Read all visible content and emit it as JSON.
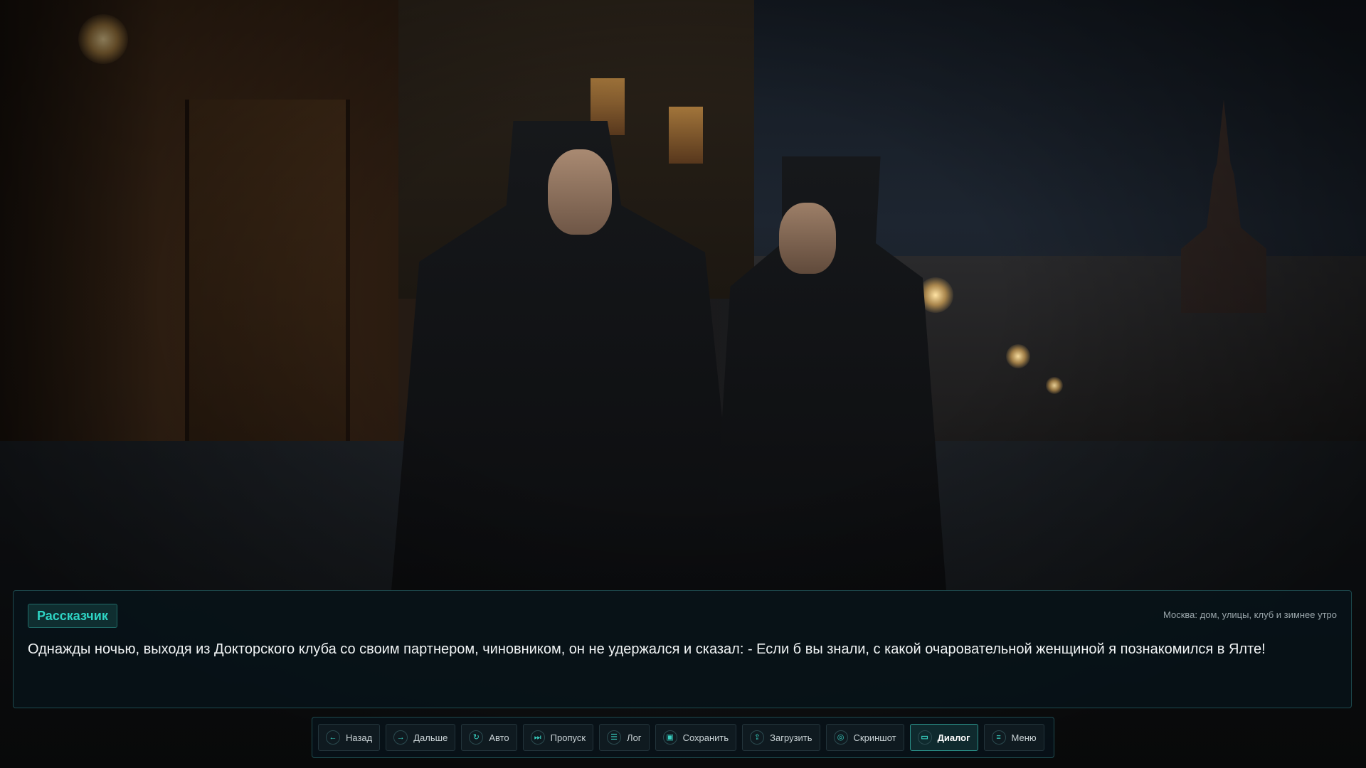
{
  "dialog": {
    "speaker": "Рассказчик",
    "location": "Москва: дом, улицы, клуб и зимнее утро",
    "text": "Однажды ночью, выходя из Докторского клуба со своим партнером, чиновником, он не удержался и сказал: - Если б вы знали, с какой очаровательной женщиной я познакомился в Ялте!"
  },
  "toolbar": {
    "buttons": [
      {
        "label": "Назад",
        "icon": "back-arrow-icon",
        "glyph": "←"
      },
      {
        "label": "Дальше",
        "icon": "forward-arrow-icon",
        "glyph": "→"
      },
      {
        "label": "Авто",
        "icon": "auto-play-icon",
        "glyph": "↻"
      },
      {
        "label": "Пропуск",
        "icon": "skip-icon",
        "glyph": "⏭"
      },
      {
        "label": "Лог",
        "icon": "log-icon",
        "glyph": "☰"
      },
      {
        "label": "Сохранить",
        "icon": "save-icon",
        "glyph": "▣"
      },
      {
        "label": "Загрузить",
        "icon": "load-icon",
        "glyph": "⇪"
      },
      {
        "label": "Скриншот",
        "icon": "camera-icon",
        "glyph": "◎"
      },
      {
        "label": "Диалог",
        "icon": "dialog-icon",
        "glyph": "▭"
      },
      {
        "label": "Меню",
        "icon": "menu-icon",
        "glyph": "≡"
      }
    ],
    "active": "Диалог"
  },
  "colors": {
    "accent": "#2ed4c4",
    "panel_bg": "#08121a",
    "panel_border": "#1d4a4e"
  }
}
